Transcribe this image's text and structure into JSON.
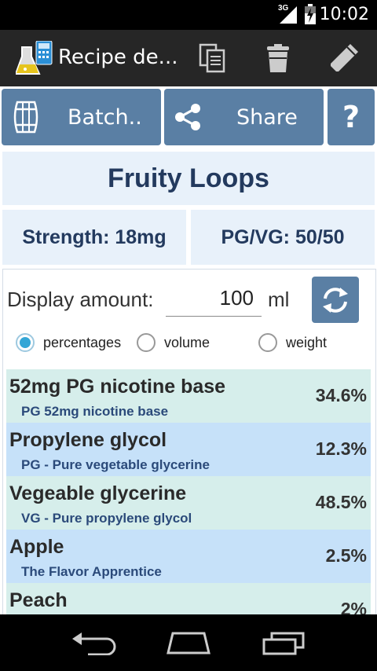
{
  "status_bar": {
    "time": "10:02",
    "network_type": "3G"
  },
  "action_bar": {
    "title": "Recipe de...",
    "icons": [
      "app-logo-icon",
      "copy-icon",
      "trash-icon",
      "edit-pencil-icon"
    ]
  },
  "top_buttons": {
    "batch_label": "Batch..",
    "share_label": "Share",
    "help_label": "?"
  },
  "recipe": {
    "name": "Fruity Loops",
    "strength": "Strength: 18mg",
    "pg_vg": "PG/VG: 50/50"
  },
  "calculator": {
    "display_amount_label": "Display amount:",
    "amount_value": "100",
    "unit": "ml",
    "mode_options": [
      "percentages",
      "volume",
      "weight"
    ],
    "selected_mode": "percentages"
  },
  "ingredients": [
    {
      "name": "52mg PG nicotine base",
      "subtitle": "PG 52mg nicotine base",
      "percent": "34.6%"
    },
    {
      "name": "Propylene glycol",
      "subtitle": "PG - Pure vegetable glycerine",
      "percent": "12.3%"
    },
    {
      "name": "Vegeable glycerine",
      "subtitle": "VG - Pure propylene glycol",
      "percent": "48.5%"
    },
    {
      "name": "Apple",
      "subtitle": "The Flavor Apprentice",
      "percent": "2.5%"
    },
    {
      "name": "Peach",
      "subtitle": "",
      "percent": "2%"
    }
  ],
  "colors": {
    "accent_blue": "#5a7fa4",
    "panel_bg": "#e8f1fa",
    "row_teal": "#d6eeeb",
    "row_blue": "#c6e1f9",
    "radio_selected": "#33a6d6"
  }
}
